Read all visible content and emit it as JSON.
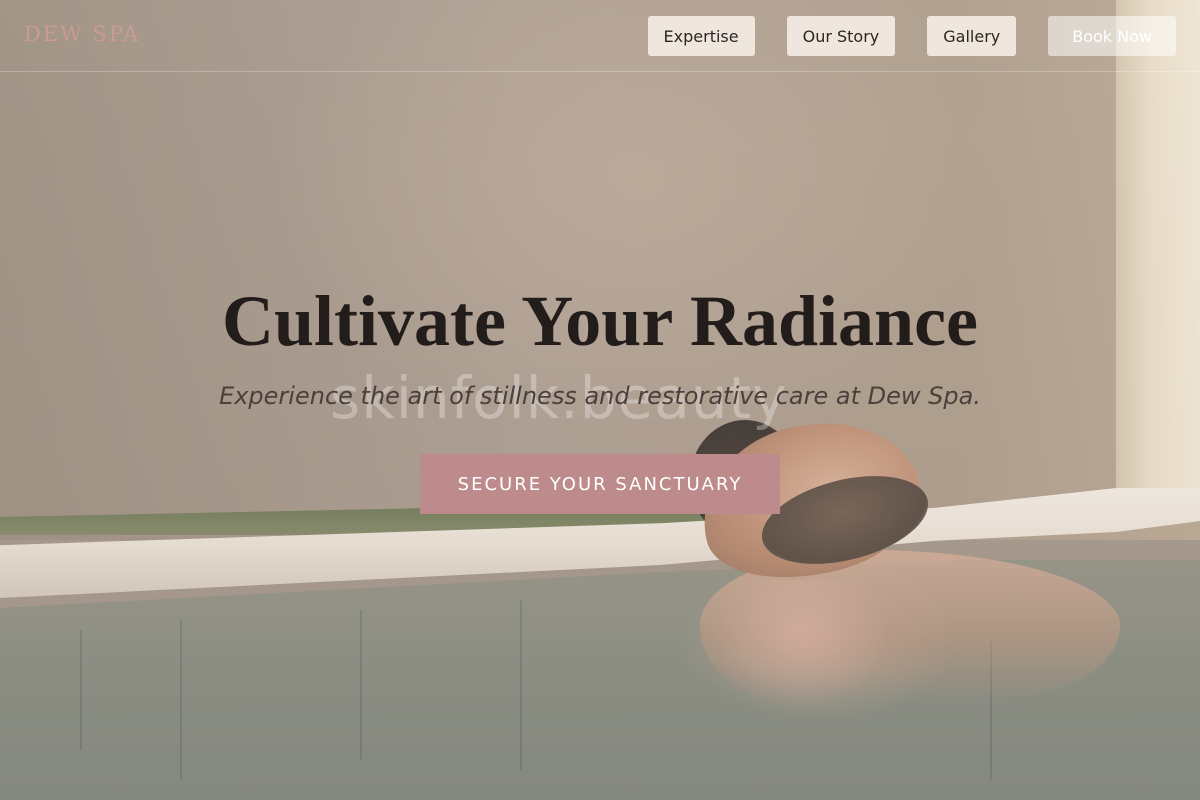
{
  "brand": {
    "name": "DEW SPA"
  },
  "nav": {
    "items": [
      {
        "label": "Expertise"
      },
      {
        "label": "Our Story"
      },
      {
        "label": "Gallery"
      }
    ],
    "book_label": "Book Now"
  },
  "hero": {
    "title": "Cultivate Your Radiance",
    "subtitle": "Experience the art of stillness and restorative care at Dew Spa.",
    "cta_label": "SECURE YOUR SANCTUARY",
    "watermark": "skinfolk.beauty"
  },
  "colors": {
    "brand_logo": "#c99a96",
    "cta_background": "#be8b8c",
    "nav_button_background": "#efe6de",
    "title_text": "#221c1a"
  }
}
